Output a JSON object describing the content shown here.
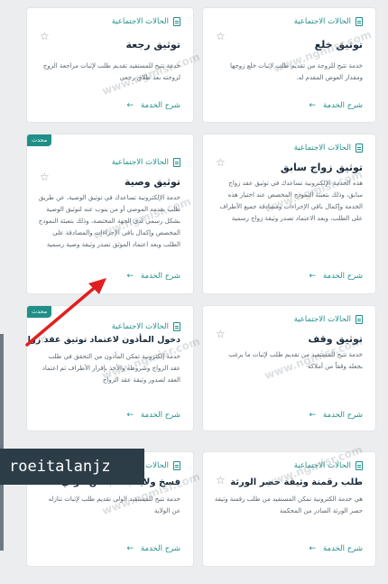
{
  "cards": [
    {
      "category": "الحالات الاجتماعية",
      "title": "توثيق خلع",
      "desc": "خدمة تتيح للزوجة من تقديم طلب لإثبات خلع زوجها ومقدار العوض المقدم له.",
      "link": "شرح الخدمة"
    },
    {
      "category": "الحالات الاجتماعية",
      "title": "توثيق رجعة",
      "desc": "خدمة تتيح للمستفيد تقديم طلب لإثبات مراجعة الزوج لزوجته بعد طلاق رجعي",
      "link": "شرح الخدمة"
    },
    {
      "category": "الحالات الاجتماعية",
      "title": "توثيق زواج سابق",
      "desc": "هذه الخدمة الإلكترونية تساعدك في توثيق عقد زواج سابق، وذلك بتعبئة النموذج المخصص عند اختيار هذه الخدمة وإكمال باقي الإجراءات ومصادقة جميع الأطراف على الطلب، وبعد الاعتماد تصدر وثيقة زواج رسمية",
      "link": "شرح الخدمة"
    },
    {
      "category": "الحالات الاجتماعية",
      "title": "توثيق وصية",
      "desc": "خدمة الإلكترونية تساعدك في توثيق الوصية، عن طريق طلب يقدمه الموصي أو من ينوب عنه لتوثيق الوصية بشكل رسمي لدى الجهة المختصة، وذلك بتعبئة النموذج المخصص وإكمال باقي الإجراءات والمصادقة على الطلب وبعد اعتماد الموثق تصدر وثيقة وصية رسمية",
      "link": "شرح الخدمة",
      "badge": "محدث"
    },
    {
      "category": "الحالات الاجتماعية",
      "title": "توثيق وقف",
      "desc": "خدمة تتيح للمستفيد من تقديم طلب لإثبات ما يرغب بجعله وقفاً من أملاكه",
      "link": "شرح الخدمة"
    },
    {
      "category": "الحالات الاجتماعية",
      "title": "دخول المأذون لاعتماد توثيق عقد زواج",
      "desc": "خدمة إلكترونية تمكن المأذون من التحقق في طلب عقد الزواج وشروطه والأخذ بإقرار الأطراف ثم اعتماد العقد لصدور وثيقة عقد الزواج",
      "link": "شرح الخدمة",
      "badge": "محدث"
    },
    {
      "category": "الحالات الاجتماعية",
      "title": "طلب رقمنة وثيقة حصر الورثة",
      "desc": "هي خدمة الكترونية تمكن المستفيد من طلب رقمنة وثيقة حصر الورثة الصادر من المحكمة",
      "link": "شرح الخدمة"
    },
    {
      "category": "الحالات الاجتماعية",
      "title": "فسخ ولاية بطلب من الولي",
      "desc": "خدمة تتيح للمستفيد الولي تقديم طلب لإثبات تنازله عن الولاية",
      "link": "شرح الخدمة"
    }
  ],
  "watermark": "www.ngmisr.com",
  "overlay_name": "roeitalanjz",
  "colors": {
    "accent": "#1f8f88",
    "arrow": "#e02020",
    "tag_bg": "#2c3d47"
  }
}
